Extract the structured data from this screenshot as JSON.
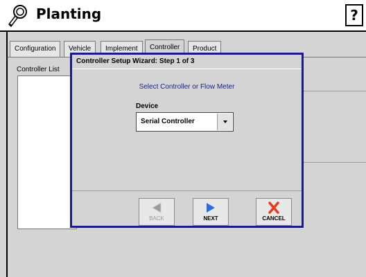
{
  "app": {
    "title": "Planting",
    "help_label": "?"
  },
  "tabs": [
    {
      "label": "Configuration"
    },
    {
      "label": "Vehicle"
    },
    {
      "label": "Implement"
    },
    {
      "label": "Controller",
      "active": true
    },
    {
      "label": "Product"
    }
  ],
  "controller_list": {
    "label": "Controller List"
  },
  "wizard": {
    "title": "Controller Setup Wizard:  Step 1 of 3",
    "subtitle": "Select Controller or Flow Meter",
    "device_label": "Device",
    "device_value": "Serial Controller",
    "buttons": {
      "back": "BACK",
      "next": "NEXT",
      "cancel": "CANCEL"
    }
  },
  "colors": {
    "wizard_border": "#1a1a8c",
    "subtitle_text": "#1a1a8c",
    "next_arrow": "#2a6de0",
    "cancel_x": "#e53a1a",
    "back_arrow_disabled": "#9a9a9a"
  },
  "icons": {
    "app": "wrench-magnifier-icon",
    "back": "left-arrow-icon",
    "next": "right-arrow-icon",
    "cancel": "x-icon",
    "dropdown": "chevron-down-icon"
  }
}
